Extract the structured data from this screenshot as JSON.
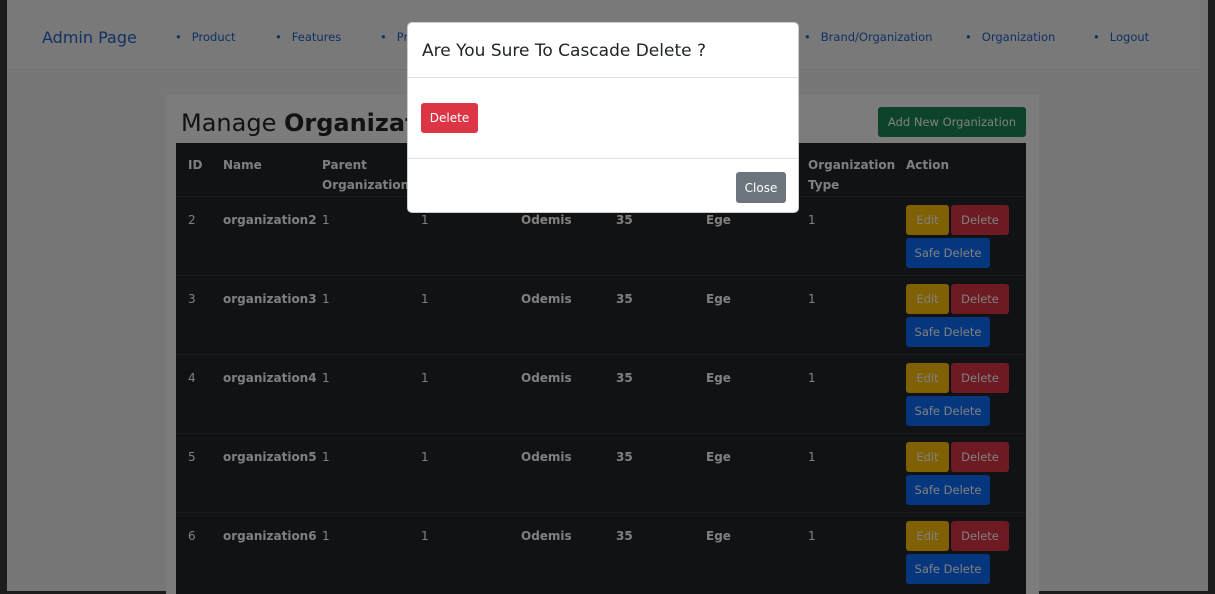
{
  "navbar": {
    "brand": "Admin Page",
    "links": [
      "Product",
      "Features",
      "Pr",
      "Brand/Organization",
      "Organization",
      "Logout"
    ]
  },
  "page": {
    "title_prefix": "Manage",
    "title_bold": "Organizati",
    "add_button": "Add New Organization"
  },
  "table": {
    "headers": [
      "ID",
      "Name",
      "Parent Organization",
      "Organization Type",
      "Action"
    ],
    "rows": [
      {
        "id": "2",
        "name": "organization2",
        "c1": "1",
        "c2": "1",
        "city": "Odemis",
        "code": "35",
        "region": "Ege",
        "type": "1"
      },
      {
        "id": "3",
        "name": "organization3",
        "c1": "1",
        "c2": "1",
        "city": "Odemis",
        "code": "35",
        "region": "Ege",
        "type": "1"
      },
      {
        "id": "4",
        "name": "organization4",
        "c1": "1",
        "c2": "1",
        "city": "Odemis",
        "code": "35",
        "region": "Ege",
        "type": "1"
      },
      {
        "id": "5",
        "name": "organization5",
        "c1": "1",
        "c2": "1",
        "city": "Odemis",
        "code": "35",
        "region": "Ege",
        "type": "1"
      },
      {
        "id": "6",
        "name": "organization6",
        "c1": "1",
        "c2": "1",
        "city": "Odemis",
        "code": "35",
        "region": "Ege",
        "type": "1"
      }
    ],
    "actions": {
      "edit": "Edit",
      "delete": "Delete",
      "safe_delete": "Safe Delete"
    }
  },
  "modal": {
    "title": "Are You Sure To Cascade Delete ?",
    "delete_button": "Delete",
    "close_button": "Close"
  },
  "colors": {
    "primary": "#0d6efd",
    "danger": "#dc3545",
    "warning": "#ffc107",
    "success": "#198754",
    "secondary": "#6c757d",
    "table_dark": "#212529"
  }
}
